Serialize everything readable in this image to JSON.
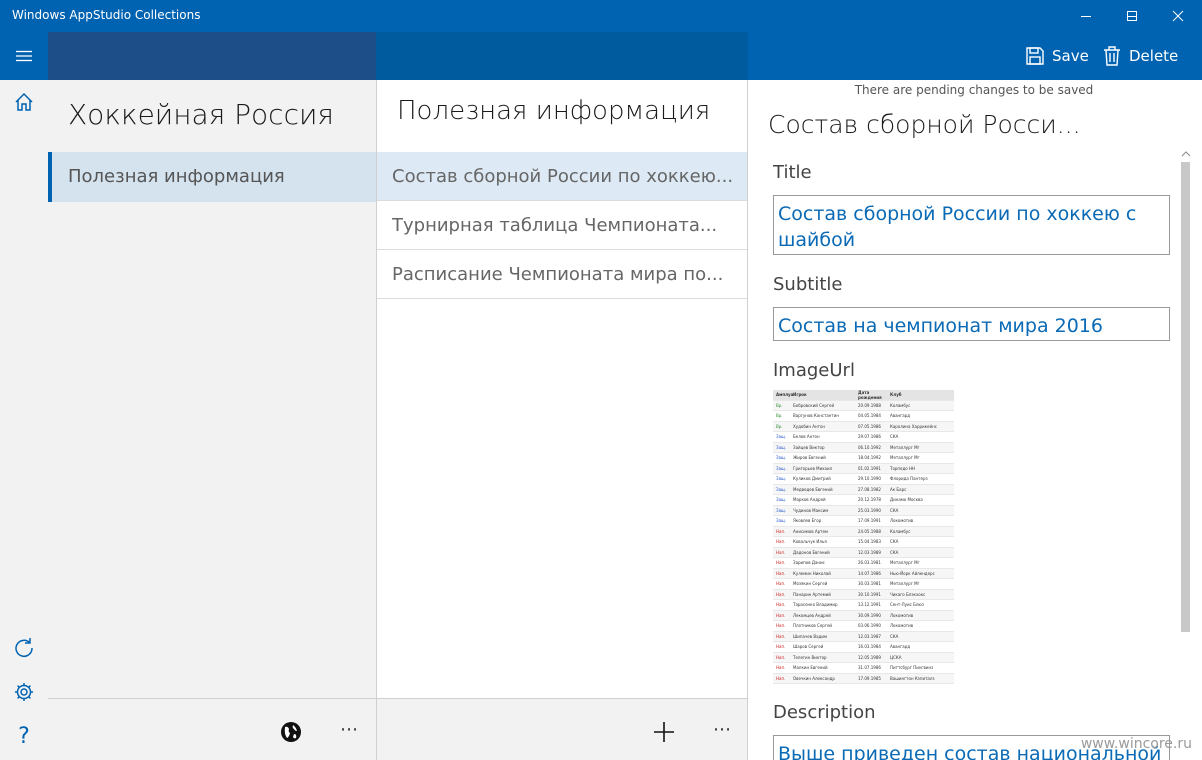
{
  "window": {
    "title": "Windows AppStudio Collections"
  },
  "toolbar": {
    "save_label": "Save",
    "delete_label": "Delete"
  },
  "pane1": {
    "heading": "Хоккейная Россия",
    "selected_item": "Полезная информация"
  },
  "pane2": {
    "heading": "Полезная информация",
    "items": [
      {
        "label": "Состав сборной России по хоккею..."
      },
      {
        "label": "Турнирная таблица Чемпионата..."
      },
      {
        "label": "Расписание Чемпионата мира по..."
      }
    ]
  },
  "detail": {
    "pending": "There are pending changes to be saved",
    "title": "Состав сборной Росси...",
    "fields": {
      "title_label": "Title",
      "title_value": "Состав сборной России по хоккею с шайбой",
      "subtitle_label": "Subtitle",
      "subtitle_value": "Состав на чемпионат мира 2016",
      "image_label": "ImageUrl",
      "description_label": "Description",
      "description_value": "Выше приведен состав национальной"
    }
  },
  "watermark": "www.wincore.ru",
  "image_table": {
    "headers": [
      "Амплуа",
      "Игрок",
      "Дата рождения",
      "Клуб"
    ],
    "rows": [
      [
        "Вр.",
        "Бобровский Сергей",
        "20.09.1988",
        "Коламбус"
      ],
      [
        "Вр.",
        "Варгунов Константин",
        "04.05.1984",
        "Авангард"
      ],
      [
        "Вр.",
        "Худобин Антон",
        "07.05.1986",
        "Каролина Харрикейнс"
      ],
      [
        "Защ.",
        "Белов Антон",
        "29.07.1986",
        "СКА"
      ],
      [
        "Защ.",
        "Зайцев Виктор",
        "06.10.1992",
        "Металлург Мг"
      ],
      [
        "Защ.",
        "Жиров Евгений",
        "18.04.1992",
        "Металлург Мг"
      ],
      [
        "Защ.",
        "Григорьев Михаил",
        "01.02.1991",
        "Торпедо НН"
      ],
      [
        "Защ.",
        "Куликов Дмитрий",
        "29.10.1990",
        "Флорида Пантерз"
      ],
      [
        "Защ.",
        "Медведев Евгений",
        "27.08.1982",
        "Ак Барс"
      ],
      [
        "Защ.",
        "Марков Андрей",
        "20.12.1978",
        "Динамо Москва"
      ],
      [
        "Защ.",
        "Чудинов Максим",
        "25.03.1990",
        "СКА"
      ],
      [
        "Защ.",
        "Яковлев Егор",
        "17.09.1991",
        "Локомотив"
      ],
      [
        "Нап.",
        "Анисимов Артем",
        "24.05.1988",
        "Коламбус"
      ],
      [
        "Нап.",
        "Ковальчук Илья",
        "15.04.1983",
        "СКА"
      ],
      [
        "Нап.",
        "Дадонов Евгений",
        "12.03.1989",
        "СКА"
      ],
      [
        "Нап.",
        "Зарипов Данис",
        "26.03.1981",
        "Металлург Мг"
      ],
      [
        "Нап.",
        "Кулемин Николай",
        "14.07.1986",
        "Нью-Йорк Айлендерс"
      ],
      [
        "Нап.",
        "Мозякин Сергей",
        "30.03.1981",
        "Металлург Мг"
      ],
      [
        "Нап.",
        "Панарин Артемий",
        "30.10.1991",
        "Чикаго Блэкхокс"
      ],
      [
        "Нап.",
        "Тарасенко Владимир",
        "13.12.1991",
        "Сент-Луис Блюз"
      ],
      [
        "Нап.",
        "Лекомцев Андрей",
        "30.09.1990",
        "Локомотив"
      ],
      [
        "Нап.",
        "Плотников Сергей",
        "03.06.1990",
        "Локомотив"
      ],
      [
        "Нап.",
        "Шипачев Вадим",
        "12.03.1987",
        "СКА"
      ],
      [
        "Нап.",
        "Шаров Сергей",
        "16.03.1984",
        "Авангард"
      ],
      [
        "Нап.",
        "Телегин Виктор",
        "12.05.1989",
        "ЦСКА"
      ],
      [
        "Нап.",
        "Малкин Евгений",
        "31.07.1986",
        "Питтсбург Пингвинз"
      ],
      [
        "Нап.",
        "Овечкин Александр",
        "17.09.1985",
        "Вашингтон Кэпиталз"
      ]
    ]
  }
}
